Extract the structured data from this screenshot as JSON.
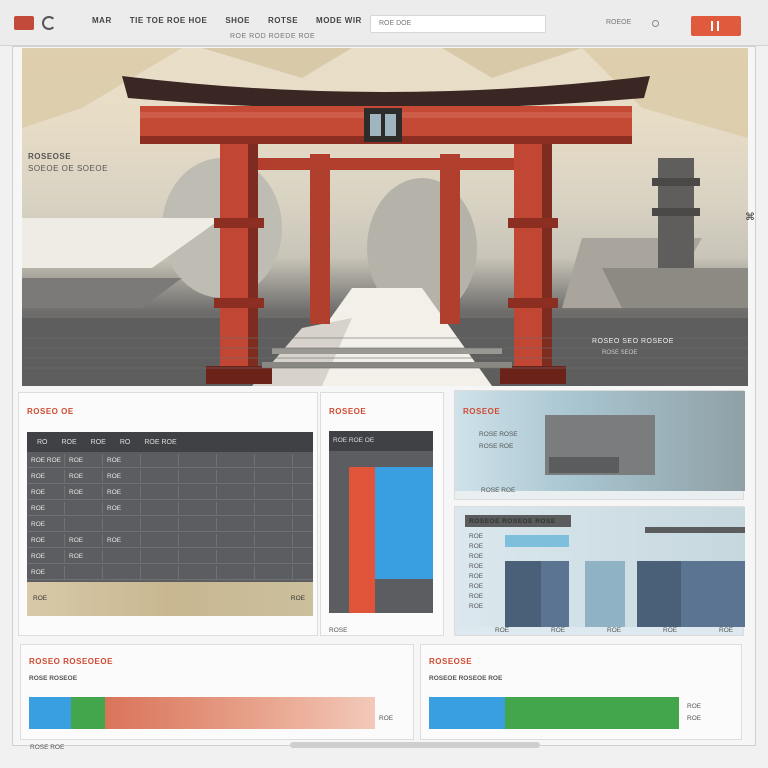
{
  "topbar": {
    "menu": [
      "MAR",
      "TIE TOE ROE HOE",
      "SHOE",
      "ROTSE",
      "MODE WIR"
    ],
    "address": "ROE DOE",
    "subbar": "ROE  ROD  ROEDE ROE",
    "status_text": "ROEOE",
    "action_label": ""
  },
  "hero": {
    "text_line1": "ROSEOSE",
    "text_line2": "SOEOE OE SOEOE",
    "caption_line1": "ROSEO SEO ROSEOE",
    "caption_line2": "ROSE SEOE",
    "handle": "⌘"
  },
  "panels": {
    "table": {
      "title": "ROSEO OE",
      "head": [
        "RO",
        "ROE",
        "ROE",
        "RO",
        "ROE ROE"
      ],
      "rows": [
        [
          "ROE ROE",
          "ROE",
          "ROE",
          "",
          "",
          "",
          ""
        ],
        [
          "ROE",
          "ROE",
          "ROE",
          "",
          "",
          "",
          ""
        ],
        [
          "ROE",
          "ROE",
          "ROE",
          "",
          "",
          "",
          ""
        ],
        [
          "ROE",
          "",
          "ROE",
          "",
          "",
          "",
          ""
        ],
        [
          "ROE",
          "",
          "",
          "",
          "",
          "",
          ""
        ],
        [
          "ROE",
          "ROE",
          "ROE",
          "",
          "",
          "",
          ""
        ],
        [
          "ROE",
          "ROE",
          "",
          "",
          "",
          "",
          ""
        ],
        [
          "ROE",
          "",
          "",
          "",
          "",
          "",
          ""
        ]
      ],
      "foot_left": "ROE",
      "foot_right": "ROE"
    },
    "bar": {
      "title": "ROSEOE",
      "head": "ROE ROE OE",
      "footer": "ROSE"
    },
    "right_top": {
      "title": "ROSEOE",
      "line2": "ROSE ROSE",
      "line3": "ROSE ROE",
      "footer": "ROSE ROE"
    },
    "right_bottom": {
      "title": "ROSEOE ROSEOE ROSE",
      "labels": [
        "ROE",
        "ROE",
        "ROE",
        "ROE",
        "ROE",
        "ROE",
        "ROE",
        "ROE"
      ],
      "axis": [
        "ROE",
        "ROE",
        "ROE",
        "ROE",
        "ROE"
      ]
    },
    "bottom_left": {
      "title": "ROSEO ROSEOEOE",
      "subtitle": "ROSE ROSEOE",
      "end_label": "ROE"
    },
    "bottom_right": {
      "title": "ROSEOSE",
      "subtitle": "ROSEOE ROSEOE ROE",
      "side1": "ROE",
      "side2": "ROE"
    }
  },
  "footer": {
    "left_text": "ROSE ROE"
  },
  "colors": {
    "accent": "#e05a3d",
    "blue": "#3a9fe0",
    "green": "#44a64c",
    "red": "#e0553a",
    "gray": "#5b5d60"
  }
}
